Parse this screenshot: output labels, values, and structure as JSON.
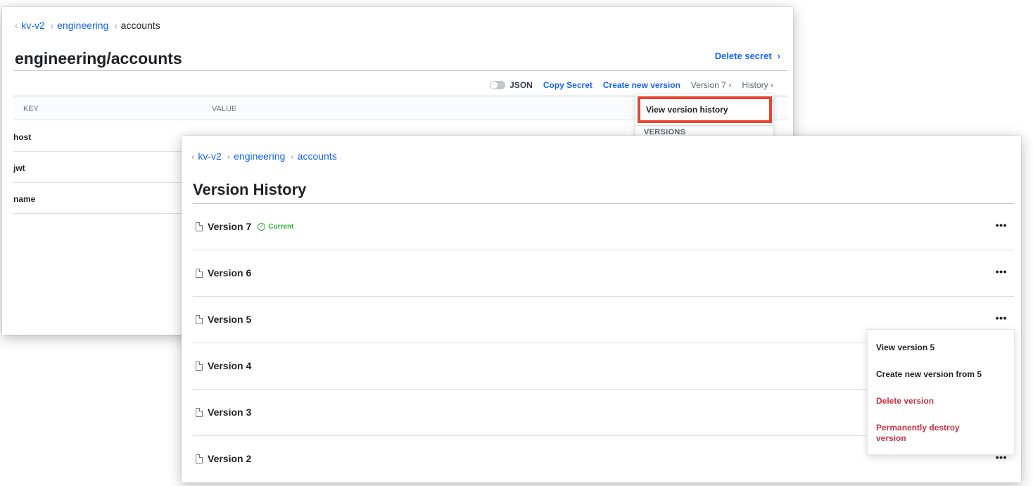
{
  "back": {
    "breadcrumbs": [
      "kv-v2",
      "engineering",
      "accounts"
    ],
    "title": "engineering/accounts",
    "delete_secret": "Delete secret",
    "toolbar": {
      "json_label": "JSON",
      "copy_secret": "Copy Secret",
      "create_new_version": "Create new version",
      "version_menu": "Version 7",
      "history_menu": "History"
    },
    "table": {
      "headers": [
        "KEY",
        "VALUE"
      ],
      "rows": [
        {
          "key": "host",
          "value_masked": "▪▪▪▪▪▪▪▪▪▪▪▪"
        },
        {
          "key": "jwt"
        },
        {
          "key": "name"
        }
      ]
    },
    "history_dropdown": {
      "view_version_history": "View version history",
      "section_label": "VERSIONS"
    }
  },
  "front": {
    "breadcrumbs": [
      "kv-v2",
      "engineering",
      "accounts"
    ],
    "title": "Version History",
    "versions": [
      {
        "label": "Version 7",
        "badge": "Current"
      },
      {
        "label": "Version 6"
      },
      {
        "label": "Version 5"
      },
      {
        "label": "Version 4"
      },
      {
        "label": "Version 3"
      },
      {
        "label": "Version 2"
      }
    ],
    "more_label": "•••",
    "version_menu": {
      "view": "View version 5",
      "create": "Create new version from 5",
      "delete": "Delete version",
      "destroy_line1": "Permanently destroy",
      "destroy_line2": "version"
    }
  },
  "colors": {
    "link": "#1563ff",
    "danger": "#c73445",
    "success": "#2eb039",
    "highlight": "#e8442c"
  },
  "icons": {
    "breadcrumb_separator": "chevron-left-icon",
    "version_item": "file-icon",
    "current_badge": "check-circle-icon",
    "row_actions": "more-horizontal-icon"
  }
}
